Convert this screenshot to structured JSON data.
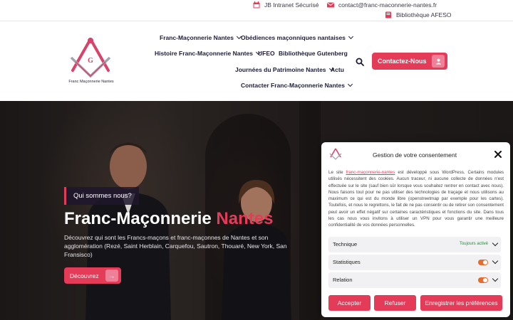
{
  "topbar": {
    "intranet": "JB Intranet Sécurisé",
    "email": "contact@franc-maconnerie-nantes.fr",
    "library": "Bibliothèque AFESO"
  },
  "brand": {
    "logo_text": "Franc Maçonnerie Nantes",
    "accent_color": "#e43b58"
  },
  "nav": {
    "items": [
      {
        "label": "Franc-Maçonnerie Nantes",
        "dropdown": true
      },
      {
        "label": "Obédiences maçonniques nantaises",
        "dropdown": true
      },
      {
        "label": "Histoire Franc-Maçonnerie Nantes",
        "dropdown": true
      },
      {
        "label": "UFEO",
        "dropdown": false
      },
      {
        "label": "Bibliothèque Gutenberg",
        "dropdown": false
      },
      {
        "label": "Journées du Patrimoine Nantes",
        "dropdown": true
      },
      {
        "label": "Actu",
        "dropdown": false
      },
      {
        "label": "Contacter Franc-Maçonnerie Nantes",
        "dropdown": true
      }
    ],
    "contact_button": "Contactez-Nous"
  },
  "hero": {
    "tagline": "Qui sommes nous?",
    "title_main": "Franc-Maçonnerie",
    "title_accent": "Nantes",
    "description": "Découvrez qui sont les Francs-maçons et franc-maçonnes de Nantes et son agglomération (Rezé, Saint Herblain, Carquefou, Sautron, Thouaré, New York, San Fransisco)",
    "button": "Découvrez"
  },
  "consent": {
    "title": "Gestion de votre consentement",
    "text_before_link": "Le site ",
    "link": "franc-maçonnerie-nantes",
    "text_after_link": " est développé sous WordPress. Certains modules utilisés nécessitent des cookies. Aucun traceur, ni aucune collecte de données n'est effectuée sur le site (sauf bien sûr lorsque vous souhaitez rentrer en contact avec nous). Nous faisons tout pour ne pas utiliser des technologies de traçage et nous utilisons au maximum ce qui est du monde libre (openstreetmap par exemple pour les cartes). Toutefois, et nous le regrettons, le fait de ne pas consentir ou de retirer son consentement peut avoir un effet négatif sur certaines caractéristiques et fonctions du site. Dans tous les cas nous vous invitons à utiliser un VPN pour vous garantir une meilleure confidentialité de vos données personnelles.",
    "categories": [
      {
        "label": "Technique",
        "status": "Toujours activé"
      },
      {
        "label": "Statistiques",
        "enabled": true
      },
      {
        "label": "Relation",
        "enabled": true
      }
    ],
    "accept": "Accepter",
    "refuse": "Refuser",
    "save": "Enregistrer les préférences"
  }
}
